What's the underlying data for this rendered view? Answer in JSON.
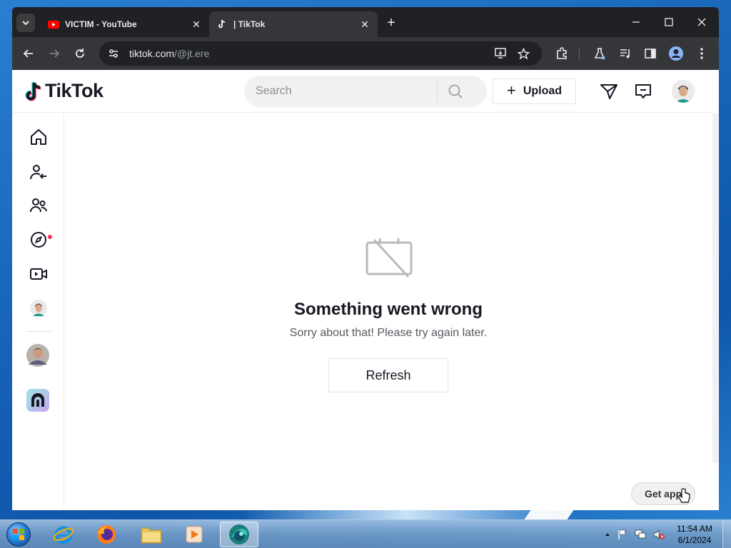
{
  "browser": {
    "tabs": [
      {
        "title": "VICTIM - YouTube",
        "favicon": "youtube-icon",
        "active": false
      },
      {
        "title": "| TikTok",
        "favicon": "tiktok-icon",
        "active": true
      }
    ],
    "url_host": "tiktok.com",
    "url_path": "/@jt.ere"
  },
  "tiktok": {
    "logo_text": "TikTok",
    "search_placeholder": "Search",
    "upload_label": "Upload",
    "error": {
      "title": "Something went wrong",
      "subtitle": "Sorry about that! Please try again later.",
      "refresh_label": "Refresh"
    },
    "get_app_label": "Get app"
  },
  "taskbar": {
    "time": "11:54 AM",
    "date": "6/1/2024"
  },
  "colors": {
    "tiktok_red": "#fe2c55",
    "tiktok_cyan": "#25f4ee",
    "chrome_dark": "#202124",
    "chrome_toolbar": "#35363a"
  }
}
